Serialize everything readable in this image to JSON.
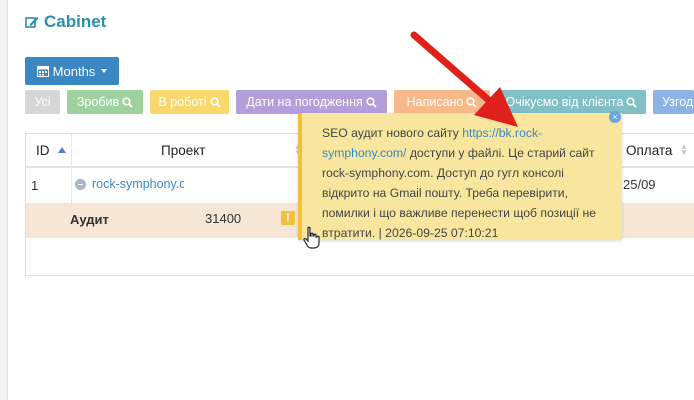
{
  "title": "Cabinet",
  "months_button": "Months",
  "filters": [
    {
      "label": "Усі",
      "color": "#d6d6d6",
      "search": false
    },
    {
      "label": "Зробив",
      "color": "#9fd19f",
      "search": true
    },
    {
      "label": "В роботі",
      "color": "#f8d86c",
      "search": true
    },
    {
      "label": "Дати на погодження",
      "color": "#b39ed9",
      "search": true
    },
    {
      "label": "Написано",
      "color": "#f7b98a",
      "search": true
    },
    {
      "label": "Очікуємо від клієнта",
      "color": "#80bfc6",
      "search": true
    },
    {
      "label": "Узгод",
      "color": "#8db2e6",
      "search": false
    }
  ],
  "table": {
    "headers": {
      "id": "ID",
      "project": "Проект",
      "payment": "Оплата"
    },
    "row1": {
      "id": "1",
      "project": "rock-symphony.c",
      "payment": "25/09"
    },
    "row2": {
      "label": "Аудит",
      "amount": "31400",
      "warn": "!"
    }
  },
  "tooltip": {
    "text_before": "SEO аудит нового сайту ",
    "link": "https://bk.rock-symphony.com/",
    "text_after": " доступи у файлі. Це старий сайт rock-symphony.com. Доступ до гугл консолі відкрито на Gmail пошту. Треба перевірити, помилки і що важливе перенести щоб позиції не втратити. | 2026-09-25 07:10:21",
    "close": "×"
  },
  "colors": {
    "accent": "#3a87c4",
    "title": "#2b8fa8",
    "tooltip_bg": "#f8e69f",
    "arrow": "#e0201a"
  }
}
